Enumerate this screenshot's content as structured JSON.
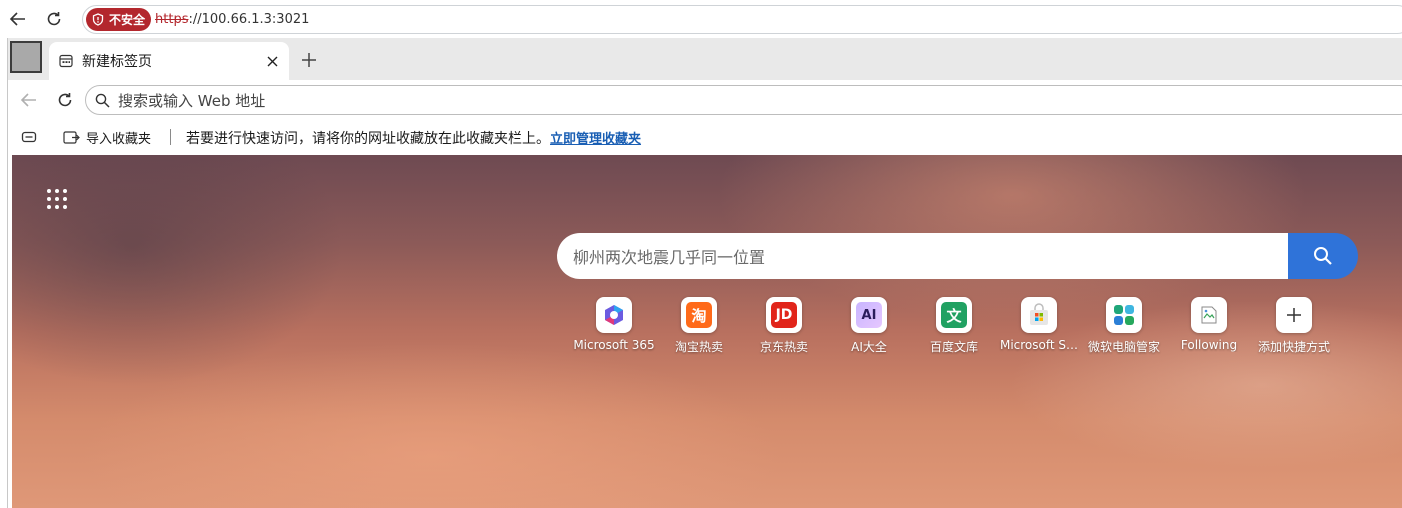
{
  "outer_bar": {
    "security_badge": "不安全",
    "url_scheme": "https",
    "url_rest": "://100.66.1.3:3021"
  },
  "tab": {
    "title": "新建标签页"
  },
  "toolbar": {
    "address_placeholder": "搜索或输入 Web 地址"
  },
  "favorites_bar": {
    "import_label": "导入收藏夹",
    "hint": "若要进行快速访问，请将你的网址收藏放在此收藏夹栏上。",
    "manage_link": "立即管理收藏夹"
  },
  "new_tab_page": {
    "search_query": "柳州两次地震几乎同一位置",
    "quick_links": [
      {
        "label": "Microsoft 365",
        "icon": "microsoft-365-icon",
        "color": "#6b5be0"
      },
      {
        "label": "淘宝热卖",
        "icon": "taobao-icon",
        "color": "#ff6a1a",
        "glyph": "淘"
      },
      {
        "label": "京东热卖",
        "icon": "jd-icon",
        "color": "#e1251b",
        "glyph": "JD"
      },
      {
        "label": "AI大全",
        "icon": "ai-icon",
        "color": "#7b4fe0",
        "glyph": "AI"
      },
      {
        "label": "百度文库",
        "icon": "baidu-wenku-icon",
        "color": "#20a162",
        "glyph": "文"
      },
      {
        "label": "Microsoft S…",
        "icon": "microsoft-store-icon",
        "color": "#e9e9e9"
      },
      {
        "label": "微软电脑管家",
        "icon": "pc-manager-icon",
        "color": "#2aa876"
      },
      {
        "label": "Following",
        "icon": "broken-image-icon",
        "color": "#ffffff"
      },
      {
        "label": "添加快捷方式",
        "icon": "plus-icon",
        "color": "#ffffff"
      }
    ]
  }
}
